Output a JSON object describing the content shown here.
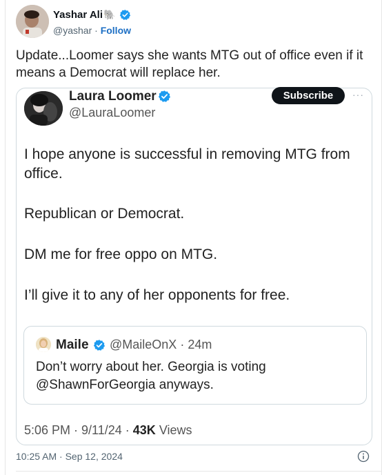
{
  "tweet": {
    "author": {
      "name": "Yashar Ali",
      "badge_emoji": "🐘",
      "handle": "@yashar",
      "separator": " · ",
      "follow_label": "Follow"
    },
    "text": "Update...Loomer says she wants MTG out of office even if it means a Democrat will replace her.",
    "timestamp": "10:25 AM · Sep 12, 2024"
  },
  "quoted": {
    "author": {
      "name": "Laura Loomer",
      "handle": "@LauraLoomer"
    },
    "subscribe_label": "Subscribe",
    "more_label": "···",
    "paragraphs": [
      "I hope anyone is successful in removing MTG from office.",
      "Republican or Democrat.",
      "DM me for free oppo on MTG.",
      "I’ll give it to any of her opponents for free."
    ],
    "inner": {
      "name": "Maile",
      "handle": "@MaileOnX",
      "age": "24m",
      "text": "Don’t worry about her. Georgia is voting @ShawnForGeorgia anyways."
    },
    "footer": {
      "time": "5:06 PM",
      "date": "9/11/24",
      "views_count": "43K",
      "views_label": "Views"
    }
  },
  "colors": {
    "verified_blue": "#1d9bf0",
    "follow_link": "#1d6fc4",
    "subscribe_bg": "#0f1419"
  },
  "icons": [
    "elephant-icon",
    "verified-badge-icon",
    "more-icon",
    "info-icon"
  ]
}
